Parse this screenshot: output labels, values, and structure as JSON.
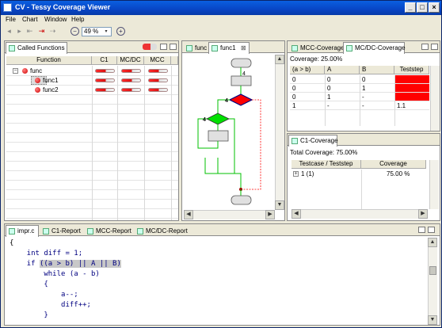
{
  "window": {
    "title": "CV - Tessy Coverage Viewer"
  },
  "menu": {
    "items": [
      "File",
      "Chart",
      "Window",
      "Help"
    ]
  },
  "toolbar": {
    "zoom_value": "49 %"
  },
  "called_functions": {
    "tab_label": "Called Functions",
    "columns": [
      "Function",
      "C1",
      "MC/DC",
      "MCC"
    ],
    "rows": [
      {
        "name": "func",
        "level": 0,
        "c1": 0.55,
        "mcdc": 0.55,
        "mcc": 0.55
      },
      {
        "name": "func1",
        "level": 1,
        "c1": 0.55,
        "mcdc": 0.55,
        "mcc": 0.55
      },
      {
        "name": "func2",
        "level": 1,
        "c1": 0.55,
        "mcdc": 0.55,
        "mcc": 0.55
      }
    ]
  },
  "flow": {
    "tabs": [
      "func",
      "func1"
    ],
    "active_tab": "func1",
    "labels": [
      "4",
      "4",
      "4"
    ]
  },
  "mcc": {
    "tabs": [
      "MCC-Coverage",
      "MC/DC-Coverage"
    ],
    "coverage_text": "Coverage: 25.00%",
    "columns": [
      "(a > b)",
      "A",
      "B",
      "Teststep"
    ],
    "rows": [
      {
        "cells": [
          "0",
          "0",
          "0",
          ""
        ],
        "fail": true
      },
      {
        "cells": [
          "0",
          "0",
          "1",
          ""
        ],
        "fail": true
      },
      {
        "cells": [
          "0",
          "1",
          "-",
          ""
        ],
        "fail": true
      },
      {
        "cells": [
          "1",
          "-",
          "-",
          "1.1"
        ],
        "fail": false
      }
    ]
  },
  "c1": {
    "tab": "C1-Coverage",
    "total_text": "Total Coverage: 75.00%",
    "columns": [
      "Testcase / Teststep",
      "Coverage"
    ],
    "rows": [
      {
        "name": "1 (1)",
        "coverage": "75.00 %"
      }
    ]
  },
  "editor": {
    "tabs": [
      "impr.c",
      "C1-Report",
      "MCC-Report",
      "MC/DC-Report"
    ],
    "lines": [
      "{",
      "    int diff = 1;",
      "    if ((a > b) || A || B)",
      "        while (a - b)",
      "        {",
      "            a--;",
      "            diff++;",
      "        }"
    ]
  },
  "colors": {
    "title_bar": "#0845c5",
    "uncovered": "#ff0000",
    "covered": "#00c000",
    "flow_node": "#e0e0e0"
  }
}
